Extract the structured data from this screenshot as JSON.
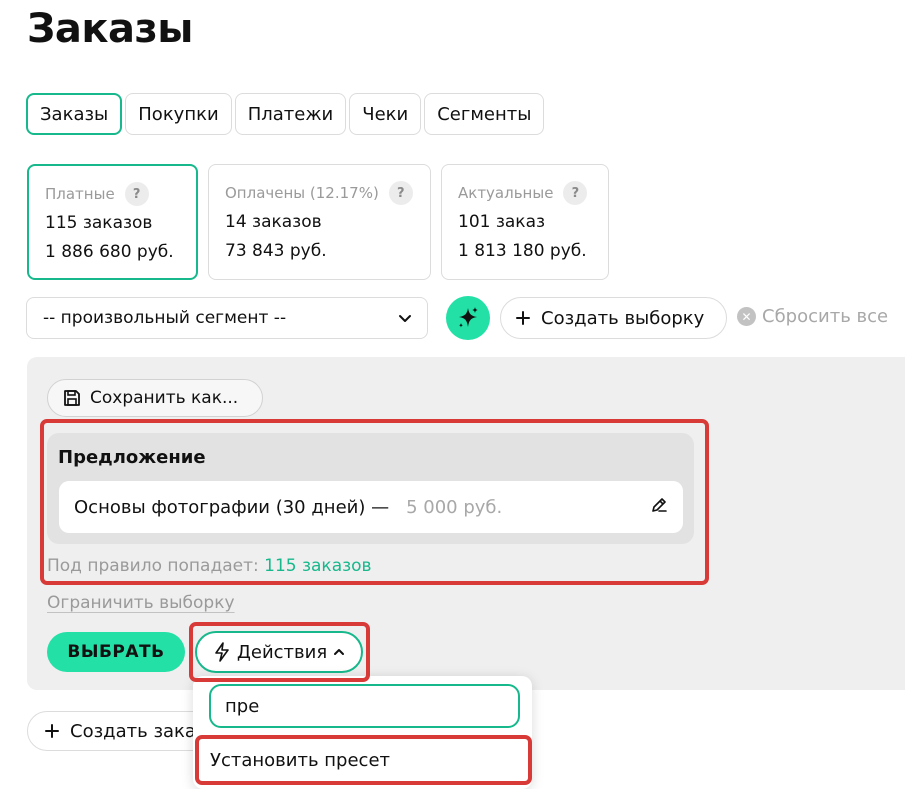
{
  "page": {
    "title": "Заказы"
  },
  "tabs": [
    {
      "label": "Заказы",
      "active": true
    },
    {
      "label": "Покупки",
      "active": false
    },
    {
      "label": "Платежи",
      "active": false
    },
    {
      "label": "Чеки",
      "active": false
    },
    {
      "label": "Сегменты",
      "active": false
    }
  ],
  "stats": [
    {
      "label": "Платные",
      "line1": "115 заказов",
      "line2": "1 886 680 руб.",
      "help": "?"
    },
    {
      "label": "Оплачены (12.17%)",
      "line1": "14 заказов",
      "line2": "73 843 руб.",
      "help": "?"
    },
    {
      "label": "Актуальные",
      "line1": "101 заказ",
      "line2": "1 813 180 руб.",
      "help": "?"
    }
  ],
  "filters": {
    "segment_value": "-- произвольный сегмент --",
    "ai_icon": "sparkle-icon",
    "create_selection_label": "Создать выборку",
    "reset_all_label": "Сбросить все"
  },
  "panel": {
    "save_as_label": "Сохранить как...",
    "offer_title": "Предложение",
    "offer_name": "Основы фотографии (30 дней) —",
    "offer_price": "5 000 руб.",
    "matches_prefix": "Под правило попадает:",
    "matches_count": "115 заказов",
    "limit_label": "Ограничить выборку",
    "select_label": "ВЫБРАТЬ",
    "actions_label": "Действия"
  },
  "create_filter_label": "Создать заказ",
  "dropdown": {
    "search_value": "пре",
    "item_label": "Установить пресет"
  },
  "colors": {
    "accent": "#17b88c",
    "accent_fill": "#22e0a6",
    "highlight": "#d83a37",
    "muted": "#9a9a9a"
  }
}
